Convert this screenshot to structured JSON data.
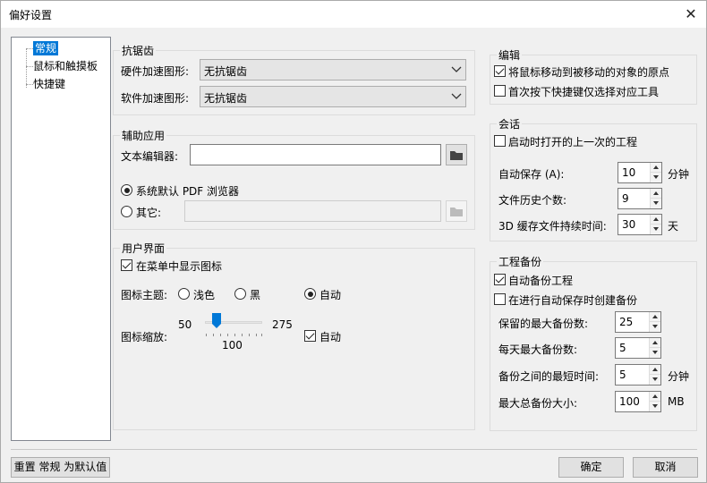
{
  "window": {
    "title": "偏好设置"
  },
  "tree": {
    "items": [
      "常规",
      "鼠标和触摸板",
      "快捷键"
    ]
  },
  "antialias": {
    "title": "抗锯齿",
    "hw_label": "硬件加速图形:",
    "hw_value": "无抗锯齿",
    "sw_label": "软件加速图形:",
    "sw_value": "无抗锯齿"
  },
  "aux": {
    "title": "辅助应用",
    "editor_label": "文本编辑器:",
    "editor_value": "",
    "pdf_default": "系统默认 PDF 浏览器",
    "pdf_other": "其它:",
    "pdf_default_checked": true
  },
  "ui": {
    "title": "用户界面",
    "show_icons": "在菜单中显示图标",
    "theme_label": "图标主题:",
    "themes": [
      "浅色",
      "黑",
      "自动"
    ],
    "theme_selected": "自动",
    "scale_label": "图标缩放:",
    "scale_min": "50",
    "scale_max": "275",
    "scale_value": "100",
    "scale_auto": "自动"
  },
  "edit": {
    "title": "编辑",
    "warp_mouse": "将鼠标移动到被移动的对象的原点",
    "first_hotkey": "首次按下快捷键仅选择对应工具",
    "warp_checked": true,
    "first_checked": false
  },
  "session": {
    "title": "会话",
    "open_last": "启动时打开的上一次的工程",
    "autosave_label": "自动保存 (A):",
    "autosave_value": "10",
    "autosave_unit": "分钟",
    "history_label": "文件历史个数:",
    "history_value": "9",
    "cache_label": "3D 缓存文件持续时间:",
    "cache_value": "30",
    "cache_unit": "天"
  },
  "backup": {
    "title": "工程备份",
    "auto_backup": "自动备份工程",
    "on_autosave": "在进行自动保存时创建备份",
    "max_label": "保留的最大备份数:",
    "max_value": "25",
    "daily_label": "每天最大备份数:",
    "daily_value": "5",
    "interval_label": "备份之间的最短时间:",
    "interval_value": "5",
    "interval_unit": "分钟",
    "total_label": "最大总备份大小:",
    "total_value": "100",
    "total_unit": "MB"
  },
  "footer": {
    "reset": "重置 常规 为默认值",
    "ok": "确定",
    "cancel": "取消"
  }
}
